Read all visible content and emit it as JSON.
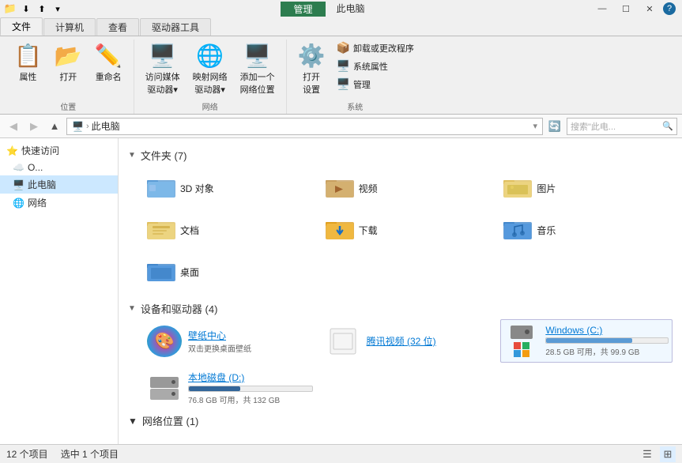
{
  "titlebar": {
    "quickaccess_icons": [
      "📁",
      "⬇",
      "↩"
    ],
    "manage_tab": "管理",
    "tab_subtitle": "此电脑",
    "tabs": [
      "文件",
      "计算机",
      "查看",
      "驱动器工具"
    ],
    "controls": [
      "—",
      "☐",
      "✕"
    ]
  },
  "ribbon": {
    "groups": [
      {
        "name": "位置",
        "buttons": [
          {
            "label": "属性",
            "icon": "📋",
            "type": "large"
          },
          {
            "label": "打开",
            "icon": "📂",
            "type": "large"
          },
          {
            "label": "重命名",
            "icon": "✏️",
            "type": "large"
          }
        ]
      },
      {
        "name": "网络",
        "buttons": [
          {
            "label": "访问媒体\n驱动器▾",
            "icon": "🖥️",
            "type": "large"
          },
          {
            "label": "映射网络\n驱动器▾",
            "icon": "🌐",
            "type": "large"
          },
          {
            "label": "添加一个\n网络位置",
            "icon": "🖥️",
            "type": "large"
          }
        ]
      },
      {
        "name": "系统",
        "buttons": [
          {
            "label": "打开\n设置",
            "icon": "⚙️",
            "type": "large"
          },
          {
            "label": "卸载或更改程序",
            "icon": "📦",
            "type": "small"
          },
          {
            "label": "系统属性",
            "icon": "🖥️",
            "type": "small"
          },
          {
            "label": "管理",
            "icon": "🖥️",
            "type": "small"
          }
        ]
      }
    ]
  },
  "addressbar": {
    "back": "◀",
    "forward": "▶",
    "up": "▲",
    "path_icon": "🖥️",
    "path_text": "此电脑",
    "refresh": "🔄",
    "search_placeholder": "搜索\"此电..."
  },
  "sidebar": {
    "sections": [
      {
        "label": "快速访问",
        "items": [
          {
            "icon": "☁️",
            "label": "O...",
            "selected": false
          },
          {
            "icon": "🖥️",
            "label": "此...",
            "selected": true
          },
          {
            "icon": "🌐",
            "label": "网...",
            "selected": false
          }
        ]
      }
    ]
  },
  "content": {
    "folders_section": {
      "label": "文件夹 (7)",
      "expanded": true,
      "items": [
        {
          "name": "3D 对象",
          "color": "blue"
        },
        {
          "name": "视频",
          "color": "brown"
        },
        {
          "name": "图片",
          "color": "yellow"
        },
        {
          "name": "文档",
          "color": "yellow"
        },
        {
          "name": "下载",
          "color": "orange"
        },
        {
          "name": "音乐",
          "color": "blue"
        },
        {
          "name": "桌面",
          "color": "blue"
        }
      ]
    },
    "devices_section": {
      "label": "设备和驱动器 (4)",
      "expanded": true,
      "items": [
        {
          "type": "wallpaper",
          "name": "壁纸中心",
          "subtitle": "双击更换桌面壁纸"
        },
        {
          "type": "tencent",
          "name": "腾讯视频 (32 位)"
        },
        {
          "type": "windows-drive",
          "name": "Windows (C:)",
          "free": "28.5 GB 可用，共 99.9 GB",
          "percent": 71,
          "color": "blue"
        },
        {
          "type": "local-disk",
          "name": "本地磁盘 (D:)",
          "free": "76.8 GB 可用，共 132 GB",
          "percent": 42,
          "color": "dark-blue"
        }
      ]
    },
    "network_section": {
      "label": "网络位置 (1)",
      "expanded": true
    }
  },
  "statusbar": {
    "count": "12 个项目",
    "selected": "选中 1 个项目"
  }
}
